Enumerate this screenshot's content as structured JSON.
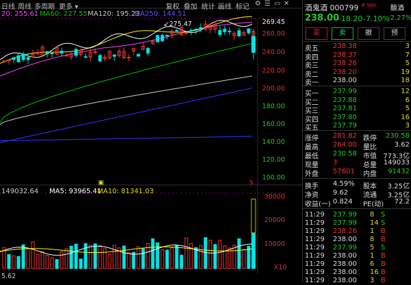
{
  "toolbar": {
    "left_tabs": [
      "日线",
      "周线",
      "多周期",
      "更多"
    ],
    "right_tabs": [
      "复权",
      "叠加",
      "统计",
      "画线",
      "标记"
    ]
  },
  "ma_legend": {
    "ma20": "20: 255.61",
    "ma60": "MA60: 227.55",
    "ma120": "MA120: 195.23",
    "ma250": "MA250: 144.51"
  },
  "price_axis": [
    "269.45",
    "260.00",
    "240.00",
    "220.00",
    "200.00",
    "180.00",
    "160.00",
    "140.00",
    "120.00",
    "100.00"
  ],
  "high_label": "275.47",
  "vol_legend": {
    "vol": "149032.64",
    "ma5": "MA5: 93965.41",
    "ma10": "MA10: 81341.03"
  },
  "vol_axis": [
    "30000",
    "20000",
    "10000"
  ],
  "vol_unit": "X10",
  "bottom_left": "5.62",
  "event_marker": "S",
  "colors": {
    "up": "#ff3333",
    "down": "#00e5e5",
    "ma5": "#ffffff",
    "ma10": "#ffff00",
    "ma20": "#ff44ff",
    "ma60": "#00c800",
    "ma120": "#cccccc",
    "ma250": "#3333ff"
  },
  "stock": {
    "name": "酒鬼酒",
    "code": "000799",
    "tag": "R 500",
    "sector": "酿酒",
    "price": "238.00",
    "change": "-18.20",
    "pct": "-7.10%",
    "sector_pct": "-2.27%"
  },
  "buttons": [
    "买",
    "卖",
    "撤",
    "预"
  ],
  "asks": [
    {
      "label": "卖五",
      "price": "238.38",
      "vol": "3"
    },
    {
      "label": "卖四",
      "price": "238.37",
      "vol": "7"
    },
    {
      "label": "卖三",
      "price": "238.26",
      "vol": "5"
    },
    {
      "label": "卖二",
      "price": "238.20",
      "vol": "19"
    },
    {
      "label": "卖一",
      "price": "238.00",
      "vol": "18"
    }
  ],
  "bids": [
    {
      "label": "买一",
      "price": "237.99",
      "vol": "12"
    },
    {
      "label": "买二",
      "price": "237.88",
      "vol": "6"
    },
    {
      "label": "买三",
      "price": "237.81",
      "vol": "5"
    },
    {
      "label": "买四",
      "price": "237.80",
      "vol": "16"
    },
    {
      "label": "买五",
      "price": "237.79",
      "vol": "3"
    }
  ],
  "stats": [
    {
      "l1": "涨停",
      "v1": "281.82",
      "l2": "跌停",
      "v2": "230.58"
    },
    {
      "l1": "最高",
      "v1": "264.00",
      "l2": "量比",
      "v2": "3.62"
    },
    {
      "l1": "最低",
      "v1": "230.58",
      "l2": "市值",
      "v2": "773.3亿"
    },
    {
      "l1": "现量",
      "v1": "3",
      "l2": "总量",
      "v2": "149033"
    },
    {
      "l1": "外盘",
      "v1": "57601",
      "l2": "内盘",
      "v2": "91432"
    }
  ],
  "stats2": [
    {
      "l1": "换手",
      "v1": "4.59%",
      "l2": "股本",
      "v2": "3.25亿"
    },
    {
      "l1": "净资",
      "v1": "9.62",
      "l2": "流通",
      "v2": "3.25亿"
    },
    {
      "l1": "收益(一)",
      "v1": "0.824",
      "l2": "PE(动)",
      "v2": "72.2"
    }
  ],
  "trades": [
    {
      "time": "11:29",
      "price": "237.99",
      "vol": "8",
      "side": "S"
    },
    {
      "time": "11:29",
      "price": "237.99",
      "vol": "14",
      "side": "S"
    },
    {
      "time": "11:29",
      "price": "238.26",
      "vol": "1",
      "side": "B"
    },
    {
      "time": "11:29",
      "price": "238.00",
      "vol": "8",
      "side": "B"
    },
    {
      "time": "11:29",
      "price": "237.99",
      "vol": "5",
      "side": "S"
    },
    {
      "time": "11:29",
      "price": "238.00",
      "vol": "1",
      "side": "B"
    },
    {
      "time": "11:29",
      "price": "238.00",
      "vol": "6",
      "side": "B"
    },
    {
      "time": "11:29",
      "price": "238.00",
      "vol": "16",
      "side": "B"
    },
    {
      "time": "11:29",
      "price": "238.00",
      "vol": "3",
      "side": "B"
    }
  ]
}
